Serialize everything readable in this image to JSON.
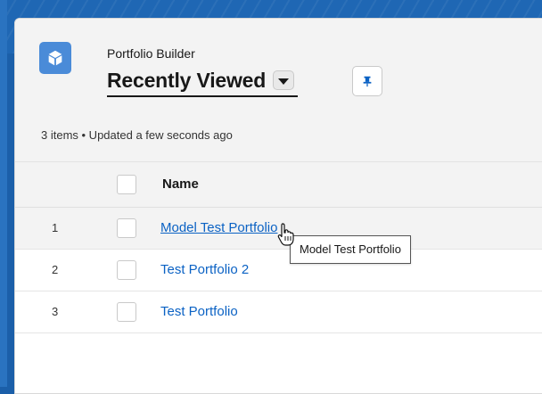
{
  "header": {
    "object_label": "Portfolio Builder",
    "list_view_title": "Recently Viewed",
    "status": "3 items • Updated a few seconds ago",
    "icons": {
      "object": "cube-icon",
      "dropdown": "chevron-down-icon",
      "pin": "pin-icon"
    }
  },
  "table": {
    "columns": [
      {
        "label": "Name"
      }
    ],
    "rows": [
      {
        "num": "1",
        "name": "Model Test Portfolio"
      },
      {
        "num": "2",
        "name": "Test Portfolio 2"
      },
      {
        "num": "3",
        "name": "Test Portfolio"
      }
    ]
  },
  "tooltip": {
    "text": "Model Test Portfolio"
  },
  "colors": {
    "link": "#0b62c4",
    "brand": "#1f67b4",
    "icon_bg": "#4a8bd8"
  }
}
